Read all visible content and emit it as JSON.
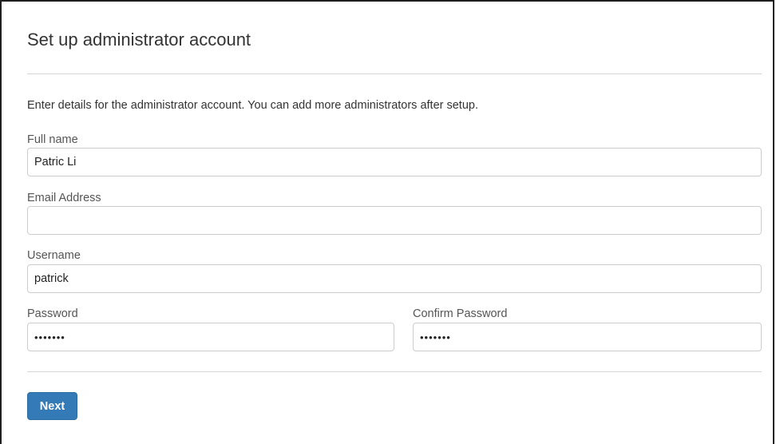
{
  "panel": {
    "title": "Set up administrator account",
    "intro": "Enter details for the administrator account. You can add more administrators after setup."
  },
  "form": {
    "full_name": {
      "label": "Full name",
      "value": "Patric Li"
    },
    "email": {
      "label": "Email Address",
      "value": ""
    },
    "username": {
      "label": "Username",
      "value": "patrick"
    },
    "password": {
      "label": "Password",
      "value": "•••••••"
    },
    "confirm_password": {
      "label": "Confirm Password",
      "value": "•••••••"
    }
  },
  "actions": {
    "next_label": "Next"
  },
  "colors": {
    "primary_button": "#337ab7",
    "input_border": "#cccccc",
    "divider": "#d6d6d6"
  }
}
